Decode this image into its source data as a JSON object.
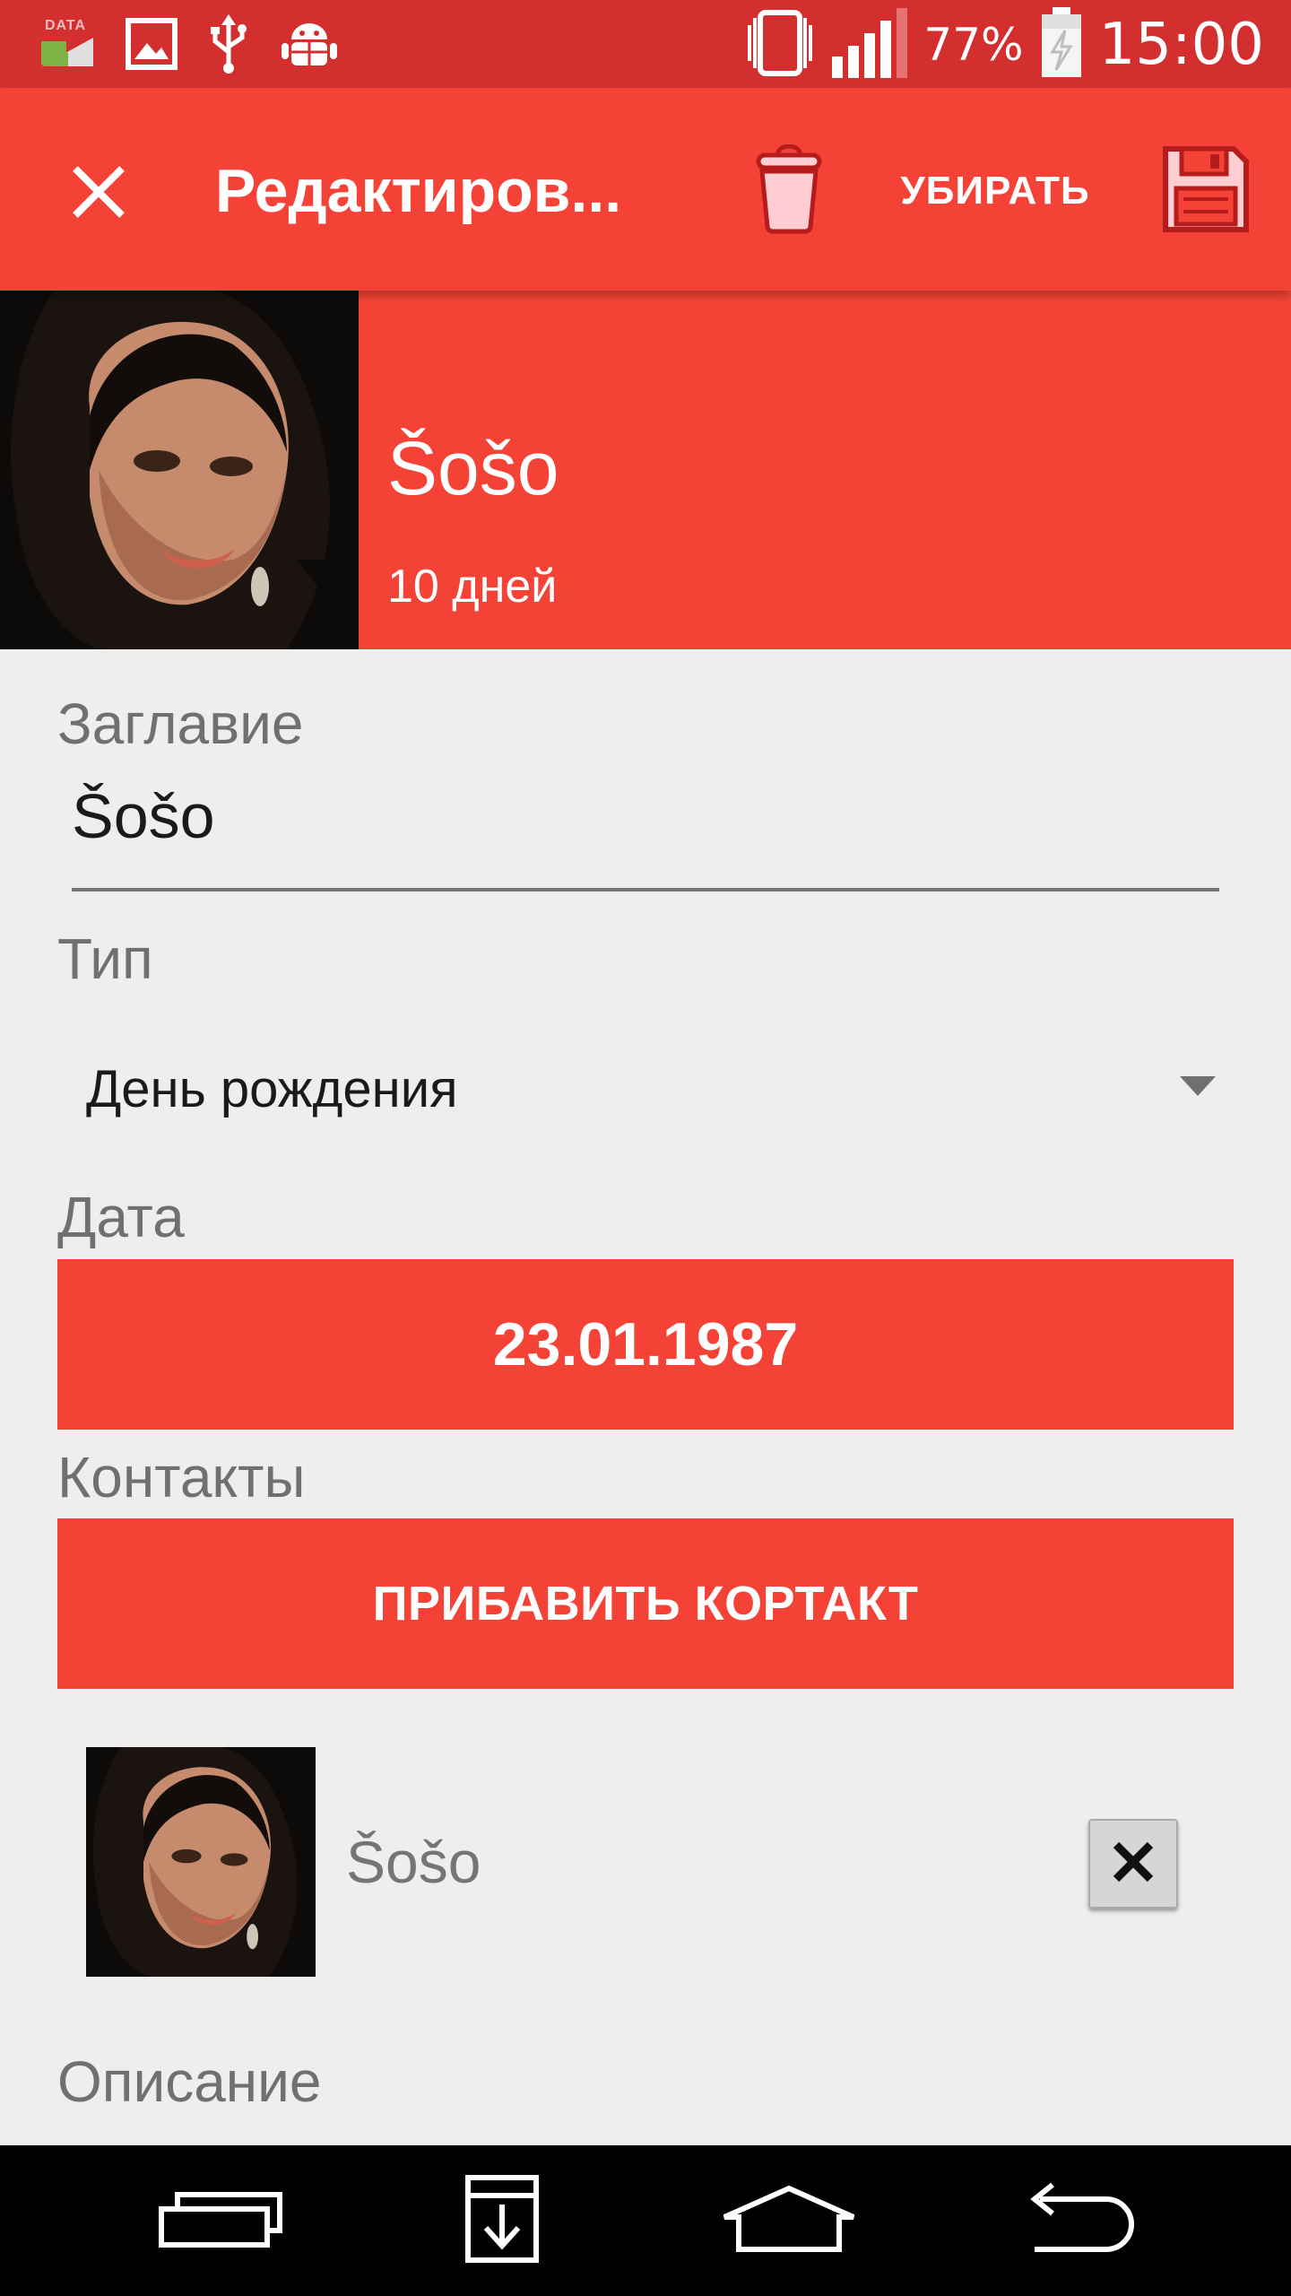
{
  "status_bar": {
    "data_label": "DATA",
    "battery_percent": "77%",
    "time": "15:00",
    "icons": [
      "data-icon",
      "gallery-icon",
      "usb-icon",
      "android-debug-icon",
      "vibrate-icon",
      "signal-icon",
      "battery-charging-icon"
    ]
  },
  "app_bar": {
    "title": "Редактиров...",
    "remove_label": "УБИРАТЬ",
    "accent": "#f44336"
  },
  "header": {
    "name": "Šošo",
    "days": "10 дней"
  },
  "form": {
    "title_label": "Заглавие",
    "title_value": "Šošo",
    "type_label": "Тип",
    "type_value": "День рождения",
    "date_label": "Дата",
    "date_value": "23.01.1987",
    "contacts_label": "Контакты",
    "add_contact_label": "ПРИБАВИТЬ КОРТАКТ",
    "contacts": [
      {
        "name": "Šošo"
      }
    ],
    "description_label": "Описание"
  },
  "colors": {
    "status_bar": "#d32f2f",
    "primary": "#f44336",
    "background": "#eeeeee"
  }
}
